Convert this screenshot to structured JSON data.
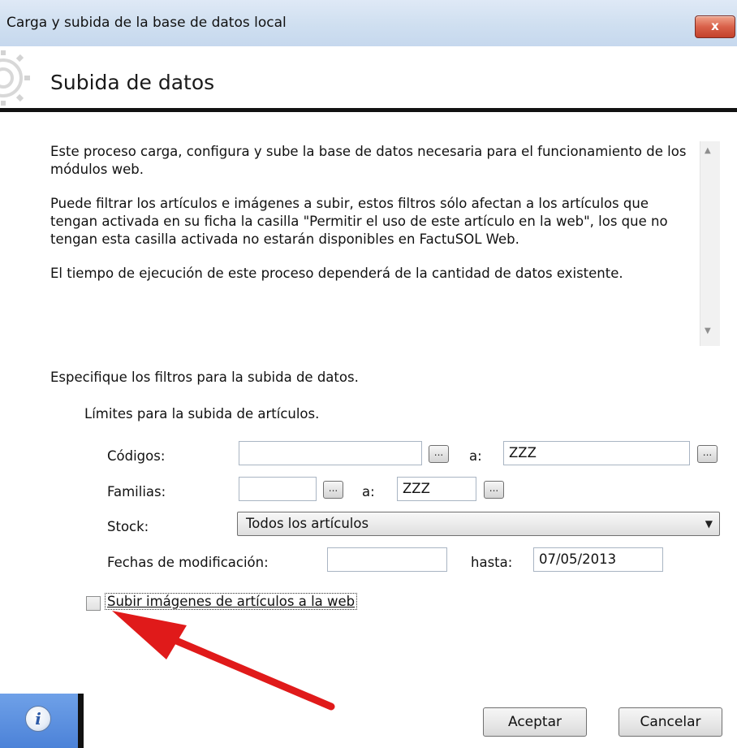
{
  "window": {
    "title": "Carga y subida de la base de datos local",
    "close_label": "x"
  },
  "header": {
    "title": "Subida de datos"
  },
  "description": {
    "paragraphs": [
      "Este proceso carga, configura y sube la base de datos necesaria para el funcionamiento de los módulos web.",
      "Puede filtrar los artículos e imágenes a subir, estos filtros sólo afectan a los artículos que tengan activada en su ficha la casilla \"Permitir el uso de este artículo en la web\", los que no tengan esta casilla activada no estarán disponibles en FactuSOL Web.",
      "El tiempo de ejecución de este proceso dependerá de la cantidad de datos existente."
    ],
    "scroll_up": "▲",
    "scroll_down": "▼"
  },
  "filters": {
    "section_title": "Especifique los filtros para la subida de datos.",
    "limits_title": "Límites para la subida de artículos.",
    "codigos": {
      "label": "Códigos:",
      "from": "",
      "to_label": "a:",
      "to": "ZZZ"
    },
    "familias": {
      "label": "Familias:",
      "from": "",
      "to_label": "a:",
      "to": "ZZZ"
    },
    "stock": {
      "label": "Stock:",
      "selected": "Todos los artículos"
    },
    "fechas": {
      "label": "Fechas de modificación:",
      "from": "",
      "to_label": "hasta:",
      "to": "07/05/2013"
    },
    "ellipsis": "..."
  },
  "upload_images": {
    "label": "Subir imágenes de artículos a la web",
    "checked": false
  },
  "footer": {
    "info_icon": "i",
    "accept": "Aceptar",
    "cancel": "Cancelar"
  },
  "colors": {
    "annotation_arrow": "#e01a1a",
    "footer_panel": "#4c82d8",
    "close_button": "#d9614a"
  }
}
